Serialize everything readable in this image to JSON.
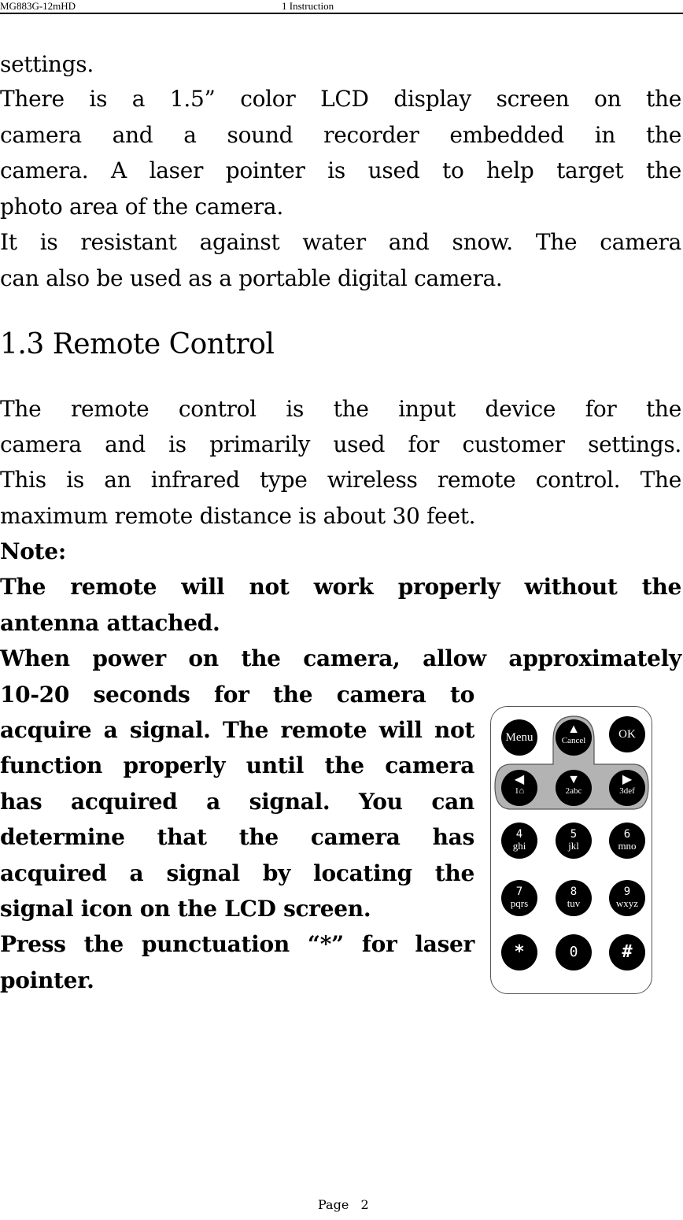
{
  "header": {
    "model": "MG883G-12mHD",
    "chapter": "1 Instruction"
  },
  "intro_lines": [
    "settings.",
    "There is a 1.5” color LCD display screen on the",
    "camera and a sound recorder embedded in the",
    "camera. A laser pointer is used to help target the",
    "photo area of the camera.",
    "It is resistant against water and snow. The camera",
    "can also be used as a portable digital camera."
  ],
  "section": {
    "heading": "1.3 Remote Control",
    "para_lines": [
      "The remote control is the input device for the",
      "camera and is primarily used for customer settings.",
      "This is an infrared type wireless remote control. The",
      "maximum remote distance is about 30 feet."
    ],
    "note_label": "Note:",
    "note_lines": [
      "The remote will not work properly without the",
      "antenna attached.",
      "When power on the camera, allow approximately",
      "10-20 seconds for the camera to",
      "acquire a signal. The remote will not",
      "function properly until the camera",
      "has acquired a signal. You can",
      "determine that the camera has",
      "acquired a signal by locating the",
      "signal icon on the LCD screen.",
      "Press the punctuation “*” for laser",
      "pointer."
    ]
  },
  "remote": {
    "menu": "Menu",
    "ok": "OK",
    "up": {
      "arrow": "▲",
      "label": "Cancel"
    },
    "left": {
      "arrow": "◀",
      "label": "1⌂"
    },
    "down": {
      "arrow": "▼",
      "label": "2abc"
    },
    "right": {
      "arrow": "▶",
      "label": "3def"
    },
    "keys": [
      {
        "main": "4",
        "sub": "ghi"
      },
      {
        "main": "5",
        "sub": "jkl"
      },
      {
        "main": "6",
        "sub": "mno"
      },
      {
        "main": "7",
        "sub": "pqrs"
      },
      {
        "main": "8",
        "sub": "tuv"
      },
      {
        "main": "9",
        "sub": "wxyz"
      }
    ],
    "star": "*",
    "zero": "0",
    "hash": "#",
    "panel_color": "#b3b3b3"
  },
  "footer": {
    "page_label": "Page   2"
  }
}
